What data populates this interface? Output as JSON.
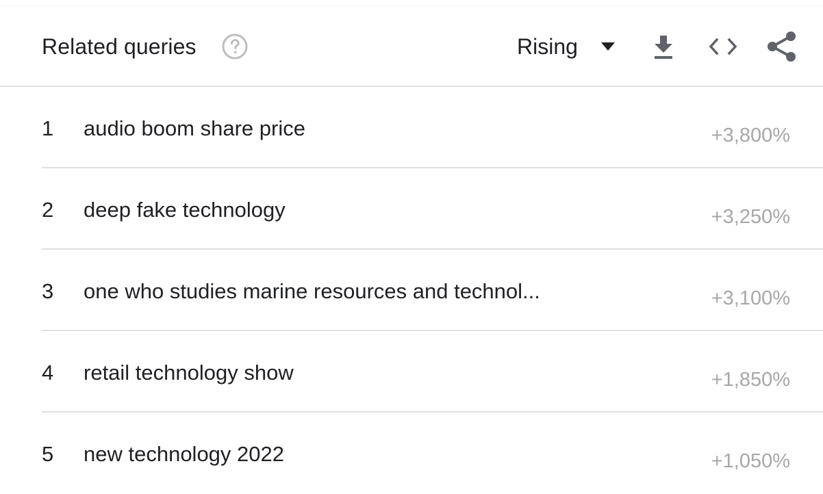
{
  "header": {
    "title": "Related queries",
    "help_icon": "help-circle-icon",
    "selector_label": "Rising",
    "dropdown_icon": "caret-down-icon",
    "actions": [
      "download-icon",
      "embed-code-icon",
      "share-icon"
    ]
  },
  "colors": {
    "text": "#202124",
    "muted_value": "#a7a7a7",
    "divider": "#e0e0e0",
    "icon_gray": "#5f6368",
    "help_gray": "#bdbdbd"
  },
  "rows": [
    {
      "rank": "1",
      "query": "audio boom share price",
      "value": "+3,800%"
    },
    {
      "rank": "2",
      "query": "deep fake technology",
      "value": "+3,250%"
    },
    {
      "rank": "3",
      "query": "one who studies marine resources and technol...",
      "value": "+3,100%"
    },
    {
      "rank": "4",
      "query": "retail technology show",
      "value": "+1,850%"
    },
    {
      "rank": "5",
      "query": "new technology 2022",
      "value": "+1,050%"
    }
  ]
}
